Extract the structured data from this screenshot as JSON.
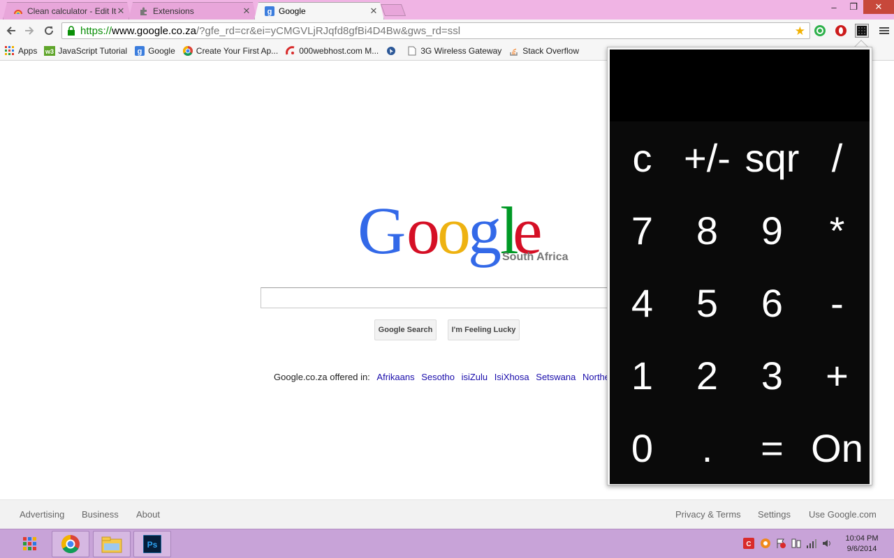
{
  "browser": {
    "tabs": [
      {
        "label": "Clean calculator - Edit Item",
        "icon": "calculator-favicon"
      },
      {
        "label": "Extensions",
        "icon": "puzzle-icon"
      },
      {
        "label": "Google",
        "icon": "google-favicon"
      }
    ],
    "active_tab": 2,
    "window_controls": {
      "minimize": "–",
      "maximize": "❐",
      "close": "✕"
    },
    "url": {
      "scheme": "https://",
      "host": "www.google.co.za",
      "rest": "/?gfe_rd=cr&ei=yCMGVLjRJqfd8gfBi4D4Bw&gws_rd=ssl"
    },
    "bookmarks": [
      {
        "label": "Apps",
        "icon": "apps-grid-icon"
      },
      {
        "label": "JavaScript Tutorial",
        "icon": "w3schools-icon"
      },
      {
        "label": "Google",
        "icon": "google-favicon"
      },
      {
        "label": "Create Your First Ap...",
        "icon": "chrome-icon"
      },
      {
        "label": "000webhost.com M...",
        "icon": "webhost-icon"
      },
      {
        "label": "",
        "icon": "cursor-icon"
      },
      {
        "label": "3G Wireless Gateway",
        "icon": "page-icon"
      },
      {
        "label": "Stack Overflow",
        "icon": "stackoverflow-icon"
      }
    ]
  },
  "page": {
    "logo_letters": [
      {
        "ch": "G",
        "color": "#3369e8"
      },
      {
        "ch": "o",
        "color": "#d50f25"
      },
      {
        "ch": "o",
        "color": "#eeb211"
      },
      {
        "ch": "g",
        "color": "#3369e8"
      },
      {
        "ch": "l",
        "color": "#009925"
      },
      {
        "ch": "e",
        "color": "#d50f25"
      }
    ],
    "logo_sub": "South Africa",
    "search_value": "",
    "search_button": "Google Search",
    "lucky_button": "I'm Feeling Lucky",
    "offered_prefix": "Google.co.za offered in:",
    "languages": [
      "Afrikaans",
      "Sesotho",
      "isiZulu",
      "IsiXhosa",
      "Setswana",
      "Northern So..."
    ]
  },
  "footer": {
    "left": [
      "Advertising",
      "Business",
      "About"
    ],
    "right": [
      "Privacy & Terms",
      "Settings",
      "Use Google.com"
    ]
  },
  "calculator": {
    "display": "",
    "keys": [
      [
        "c",
        "+/-",
        "sqr",
        "/"
      ],
      [
        "7",
        "8",
        "9",
        "*"
      ],
      [
        "4",
        "5",
        "6",
        "-"
      ],
      [
        "1",
        "2",
        "3",
        "+"
      ],
      [
        "0",
        ".",
        "=",
        "On"
      ]
    ]
  },
  "taskbar": {
    "apps": [
      "Google Chrome",
      "File Explorer",
      "Photoshop"
    ],
    "clock_time": "10:04 PM",
    "clock_date": "9/6/2014"
  }
}
